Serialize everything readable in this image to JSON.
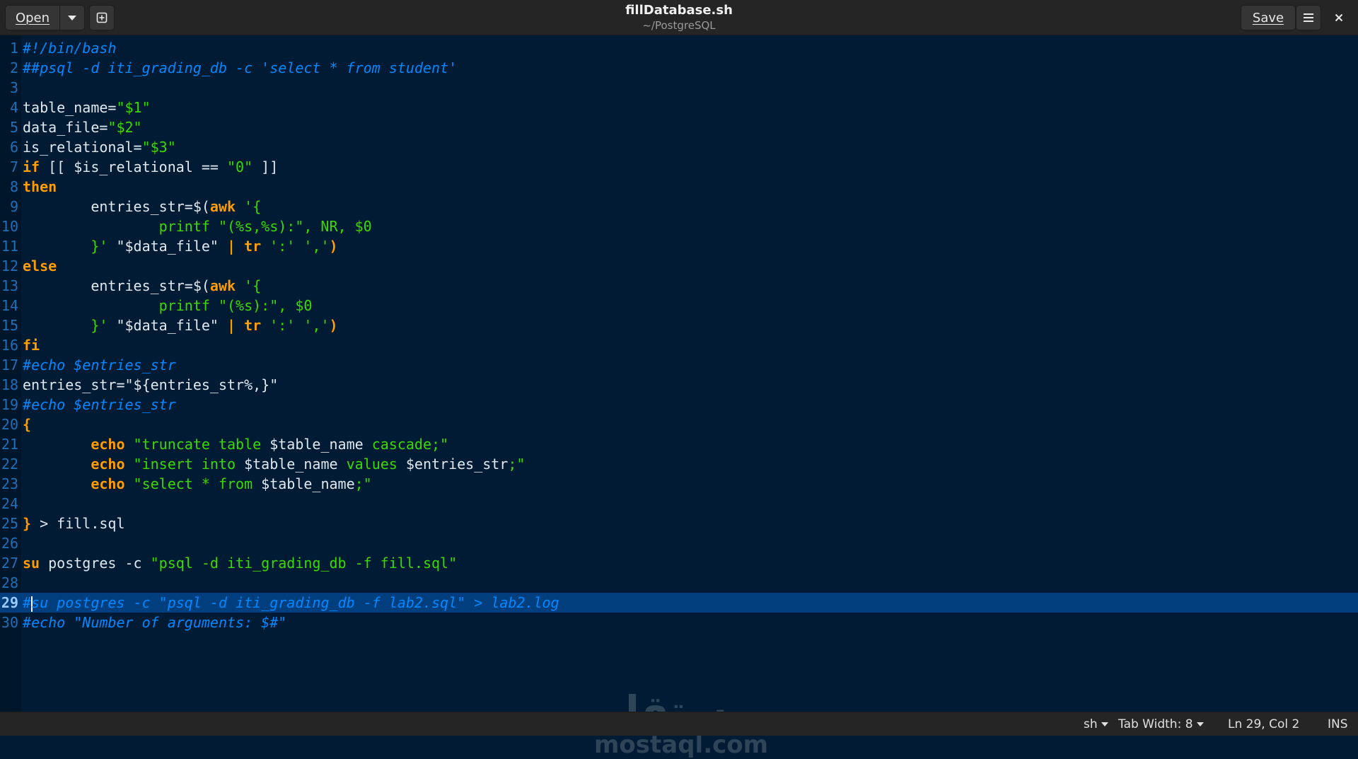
{
  "header": {
    "open_label": "Open",
    "save_label": "Save",
    "title": "fillDatabase.sh",
    "subtitle": "~/PostgreSQL",
    "open_menu_icon": "chevron-down-icon",
    "new_tab_icon": "new-tab-icon",
    "menu_icon": "hamburger-menu-icon",
    "close_icon": "close-icon"
  },
  "editor": {
    "current_line": 29,
    "lines": [
      {
        "n": "1",
        "segs": [
          {
            "t": "#!/bin/bash",
            "c": "comment"
          }
        ]
      },
      {
        "n": "2",
        "segs": [
          {
            "t": "##psql -d iti_grading_db -c 'select * from student'",
            "c": "comment"
          }
        ]
      },
      {
        "n": "3",
        "segs": []
      },
      {
        "n": "4",
        "segs": [
          {
            "t": "table_name=",
            "c": "plain"
          },
          {
            "t": "\"$1\"",
            "c": "str"
          }
        ]
      },
      {
        "n": "5",
        "segs": [
          {
            "t": "data_file=",
            "c": "plain"
          },
          {
            "t": "\"$2\"",
            "c": "str"
          }
        ]
      },
      {
        "n": "6",
        "segs": [
          {
            "t": "is_relational=",
            "c": "plain"
          },
          {
            "t": "\"$3\"",
            "c": "str"
          }
        ]
      },
      {
        "n": "7",
        "segs": [
          {
            "t": "if",
            "c": "kw"
          },
          {
            "t": " [[ $is_relational == ",
            "c": "plain"
          },
          {
            "t": "\"0\"",
            "c": "str"
          },
          {
            "t": " ]]",
            "c": "plain"
          }
        ]
      },
      {
        "n": "8",
        "segs": [
          {
            "t": "then",
            "c": "kw"
          }
        ]
      },
      {
        "n": "9",
        "segs": [
          {
            "t": "        entries_str=$(",
            "c": "plain"
          },
          {
            "t": "awk",
            "c": "kw"
          },
          {
            "t": " '{",
            "c": "str"
          }
        ]
      },
      {
        "n": "10",
        "segs": [
          {
            "t": "                printf \"(%s,%s):\", NR, $0",
            "c": "str"
          }
        ]
      },
      {
        "n": "11",
        "segs": [
          {
            "t": "        }'",
            "c": "str"
          },
          {
            "t": " \"$data_file\" ",
            "c": "plain"
          },
          {
            "t": "|",
            "c": "kw"
          },
          {
            "t": " ",
            "c": "plain"
          },
          {
            "t": "tr",
            "c": "kw"
          },
          {
            "t": " ':' ','",
            "c": "str"
          },
          {
            "t": ")",
            "c": "kw"
          }
        ]
      },
      {
        "n": "12",
        "segs": [
          {
            "t": "else",
            "c": "kw"
          }
        ]
      },
      {
        "n": "13",
        "segs": [
          {
            "t": "        entries_str=$(",
            "c": "plain"
          },
          {
            "t": "awk",
            "c": "kw"
          },
          {
            "t": " '{",
            "c": "str"
          }
        ]
      },
      {
        "n": "14",
        "segs": [
          {
            "t": "                printf \"(%s):\", $0",
            "c": "str"
          }
        ]
      },
      {
        "n": "15",
        "segs": [
          {
            "t": "        }'",
            "c": "str"
          },
          {
            "t": " \"$data_file\" ",
            "c": "plain"
          },
          {
            "t": "|",
            "c": "kw"
          },
          {
            "t": " ",
            "c": "plain"
          },
          {
            "t": "tr",
            "c": "kw"
          },
          {
            "t": " ':' ','",
            "c": "str"
          },
          {
            "t": ")",
            "c": "kw"
          }
        ]
      },
      {
        "n": "16",
        "segs": [
          {
            "t": "fi",
            "c": "kw"
          }
        ]
      },
      {
        "n": "17",
        "segs": [
          {
            "t": "#echo $entries_str",
            "c": "comment"
          }
        ]
      },
      {
        "n": "18",
        "segs": [
          {
            "t": "entries_str=\"${entries_str%,}\"",
            "c": "plain"
          }
        ]
      },
      {
        "n": "19",
        "segs": [
          {
            "t": "#echo $entries_str",
            "c": "comment"
          }
        ]
      },
      {
        "n": "20",
        "segs": [
          {
            "t": "{",
            "c": "kw"
          }
        ]
      },
      {
        "n": "21",
        "segs": [
          {
            "t": "        ",
            "c": "plain"
          },
          {
            "t": "echo",
            "c": "kw"
          },
          {
            "t": " \"truncate table ",
            "c": "str"
          },
          {
            "t": "$table_name",
            "c": "plain"
          },
          {
            "t": " cascade;\"",
            "c": "str"
          }
        ]
      },
      {
        "n": "22",
        "segs": [
          {
            "t": "        ",
            "c": "plain"
          },
          {
            "t": "echo",
            "c": "kw"
          },
          {
            "t": " \"insert into ",
            "c": "str"
          },
          {
            "t": "$table_name",
            "c": "plain"
          },
          {
            "t": " values ",
            "c": "str"
          },
          {
            "t": "$entries_str",
            "c": "plain"
          },
          {
            "t": ";\"",
            "c": "str"
          }
        ]
      },
      {
        "n": "23",
        "segs": [
          {
            "t": "        ",
            "c": "plain"
          },
          {
            "t": "echo",
            "c": "kw"
          },
          {
            "t": " \"select * from ",
            "c": "str"
          },
          {
            "t": "$table_name",
            "c": "plain"
          },
          {
            "t": ";\"",
            "c": "str"
          }
        ]
      },
      {
        "n": "24",
        "segs": []
      },
      {
        "n": "25",
        "segs": [
          {
            "t": "}",
            "c": "kw"
          },
          {
            "t": " > fill.sql",
            "c": "plain"
          }
        ]
      },
      {
        "n": "26",
        "segs": []
      },
      {
        "n": "27",
        "segs": [
          {
            "t": "su",
            "c": "kw"
          },
          {
            "t": " postgres -c ",
            "c": "plain"
          },
          {
            "t": "\"psql -d iti_grading_db -f fill.sql\"",
            "c": "str"
          }
        ]
      },
      {
        "n": "28",
        "segs": []
      },
      {
        "n": "29",
        "segs": [
          {
            "t": "#",
            "c": "comment"
          },
          {
            "t": "CURSOR",
            "c": "cursor"
          },
          {
            "t": "su postgres -c \"psql -d iti_grading_db -f lab2.sql\" > lab2.log",
            "c": "comment"
          }
        ]
      },
      {
        "n": "30",
        "segs": [
          {
            "t": "#echo \"Number of arguments: $#\"",
            "c": "comment"
          }
        ]
      }
    ]
  },
  "watermark": {
    "arabic": "مستقل",
    "latin": "mostaql.com"
  },
  "status": {
    "language": "sh",
    "tab_width": "Tab Width: 8",
    "position": "Ln 29, Col 2",
    "mode": "INS"
  },
  "colors": {
    "background": "#001b33",
    "comment": "#0088ff",
    "keyword": "#ff9d00",
    "string": "#3ad900",
    "current_line": "#003e7e"
  }
}
